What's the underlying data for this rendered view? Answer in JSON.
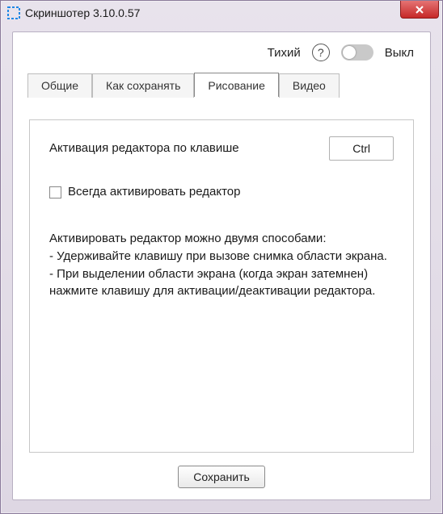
{
  "window": {
    "title": "Скриншотер 3.10.0.57"
  },
  "topbar": {
    "quiet_label": "Тихий",
    "toggle_state_label": "Выкл"
  },
  "tabs": {
    "items": [
      "Общие",
      "Как сохранять",
      "Рисование",
      "Видео"
    ],
    "active_index": 2
  },
  "panel": {
    "activation_label": "Активация редактора по клавише",
    "key_value": "Ctrl",
    "always_activate_label": "Всегда активировать редактор",
    "always_activate_checked": false,
    "description": "Активировать редактор можно двумя способами:\n- Удерживайте клавишу при вызове снимка области экрана.\n- При выделении области экрана (когда экран затемнен) нажмите клавишу для активации/деактивации редактора."
  },
  "footer": {
    "save_label": "Сохранить"
  }
}
